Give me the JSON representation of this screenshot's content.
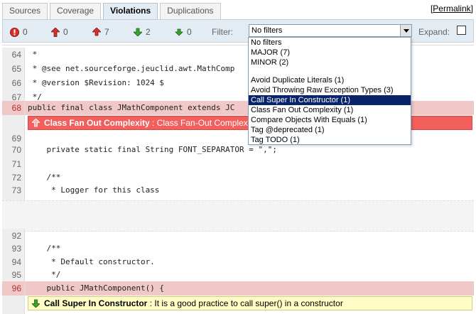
{
  "tabs": [
    {
      "label": "Sources",
      "active": false
    },
    {
      "label": "Coverage",
      "active": false
    },
    {
      "label": "Violations",
      "active": true
    },
    {
      "label": "Duplications",
      "active": false
    }
  ],
  "permalink": {
    "label": "Permalink",
    "open": "[",
    "close": "]"
  },
  "toolbar": {
    "counts": {
      "blocker": "0",
      "critical": "0",
      "major": "7",
      "minor": "2",
      "info": "0"
    },
    "filter_label": "Filter:",
    "filter_value": "No filters",
    "expand_label": "Expand:"
  },
  "dropdown": {
    "options": [
      "No filters",
      "MAJOR (7)",
      "MINOR (2)",
      "",
      "Avoid Duplicate Literals (1)",
      "Avoid Throwing Raw Exception Types (3)",
      "Call Super In Constructor (1)",
      "Class Fan Out Complexity (1)",
      "Compare Objects With Equals (1)",
      "Tag @deprecated (1)",
      "Tag TODO (1)"
    ],
    "selected_index": 6
  },
  "code": {
    "l64": {
      "n": "64",
      "t": " *"
    },
    "l65": {
      "n": "65",
      "t": " * @see net.sourceforge.jeuclid.awt.MathComp"
    },
    "l66": {
      "n": "66",
      "t": " * @version $Revision: 1024 $"
    },
    "l67": {
      "n": "67",
      "t": " */"
    },
    "l68": {
      "n": "68",
      "t": "public final class JMathComponent extends JC                            s {"
    },
    "l69": {
      "n": "69",
      "t": ""
    },
    "l70": {
      "n": "70",
      "t": "    private static final String FONT_SEPARATOR = \",\";"
    },
    "l71": {
      "n": "71",
      "t": ""
    },
    "l72": {
      "n": "72",
      "t": "    /**"
    },
    "l73": {
      "n": "73",
      "t": "     * Logger for this class"
    },
    "l92": {
      "n": "92",
      "t": ""
    },
    "l93": {
      "n": "93",
      "t": "    /**"
    },
    "l94": {
      "n": "94",
      "t": "     * Default constructor."
    },
    "l95": {
      "n": "95",
      "t": "     */"
    },
    "l96": {
      "n": "96",
      "t": "    public JMathComponent() {"
    }
  },
  "violations": {
    "v1": {
      "title": "Class Fan Out Complexity",
      "message": " : Class Fan-Out Complex"
    },
    "v2": {
      "title": "Call Super In Constructor",
      "message": " : It is a good practice to call super() in a constructor"
    }
  },
  "colors": {
    "major": "#f25f5c",
    "minor": "#fffcc6",
    "selected": "#0a246a",
    "highlight": "#f0c8c8"
  }
}
